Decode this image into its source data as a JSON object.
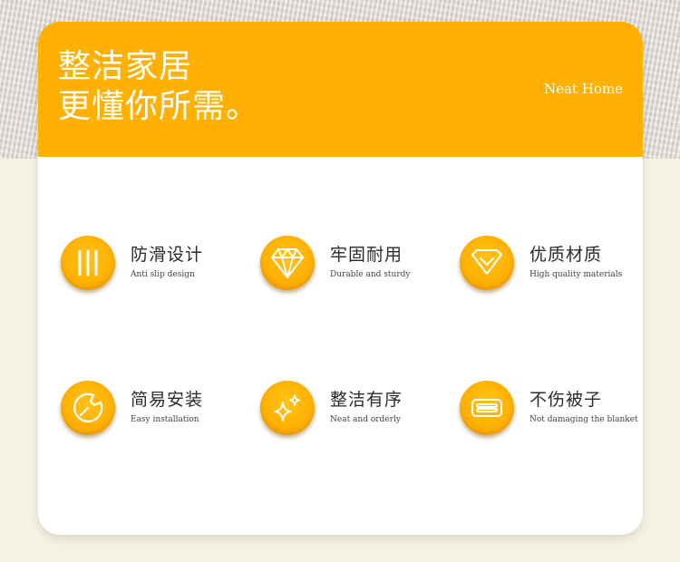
{
  "header": {
    "headline_line1": "整洁家居",
    "headline_line2": "更懂你所需。",
    "brand": "Neat Home"
  },
  "features": [
    {
      "title": "防滑设计",
      "subtitle": "Anti slip design",
      "icon": "anti-slip-icon"
    },
    {
      "title": "牢固耐用",
      "subtitle": "Durable and sturdy",
      "icon": "diamond-icon"
    },
    {
      "title": "优质材质",
      "subtitle": "High quality materials",
      "icon": "quality-gem-icon"
    },
    {
      "title": "简易安装",
      "subtitle": "Easy installation",
      "icon": "wrench-icon"
    },
    {
      "title": "整洁有序",
      "subtitle": "Neat and orderly",
      "icon": "sparkle-icon"
    },
    {
      "title": "不伤被子",
      "subtitle": "Not damaging the blanket",
      "icon": "blanket-icon"
    }
  ],
  "colors": {
    "accent": "#ffb000",
    "card": "#ffffff",
    "background": "#f6f2e3",
    "text": "#2b2b2b"
  }
}
